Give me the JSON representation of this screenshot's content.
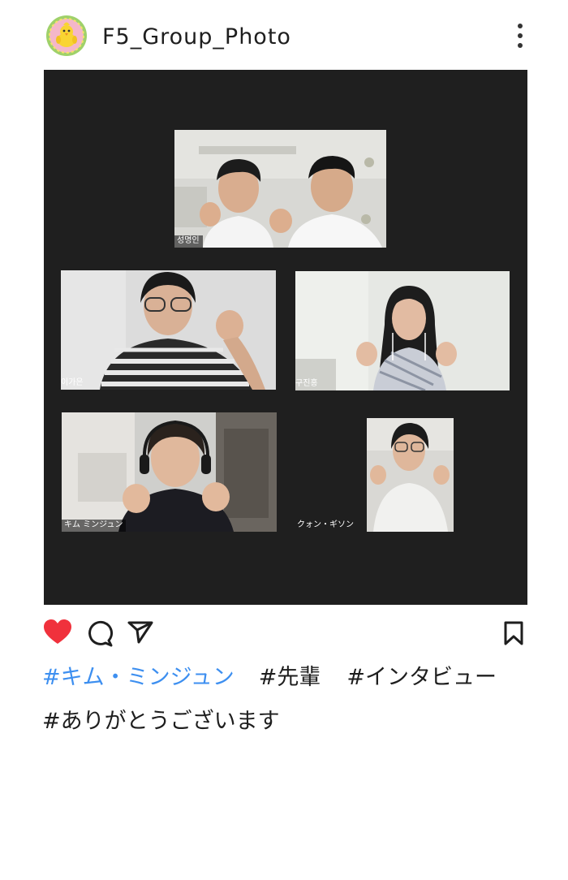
{
  "post": {
    "username": "F5_Group_Photo",
    "avatar_icon": "chick-icon",
    "liked": true,
    "colors": {
      "like": "#f0313c",
      "hashtag_link": "#3d8ff0",
      "photo_background": "#1f1f1f"
    }
  },
  "photo": {
    "participants": [
      {
        "name": "성명인"
      },
      {
        "name": "이가은"
      },
      {
        "name": "구진홍"
      },
      {
        "name": "キム ミンジュン"
      },
      {
        "name": "クォン・ギソン"
      }
    ]
  },
  "actions": [
    {
      "icon": "heart-icon"
    },
    {
      "icon": "comment-icon"
    },
    {
      "icon": "share-icon"
    },
    {
      "icon": "bookmark-icon"
    }
  ],
  "caption": {
    "hashtags": [
      "#キム・ミンジュン",
      "#先輩",
      "#インタビュー",
      "#ありがとうございます"
    ]
  }
}
